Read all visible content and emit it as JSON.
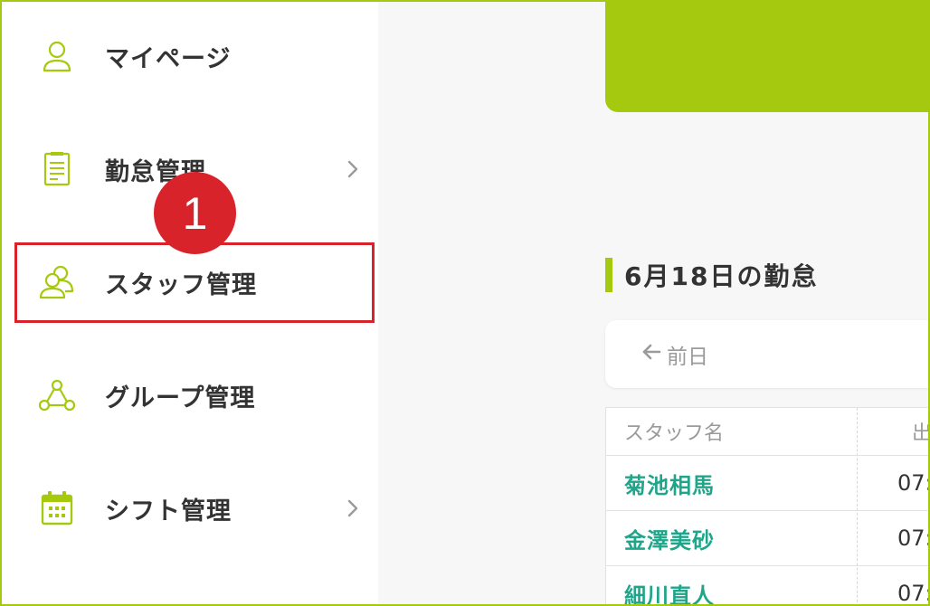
{
  "sidebar": {
    "items": [
      {
        "label": "マイページ",
        "icon": "user-icon",
        "has_chevron": false
      },
      {
        "label": "勤怠管理",
        "icon": "document-icon",
        "has_chevron": true
      },
      {
        "label": "スタッフ管理",
        "icon": "users-icon",
        "has_chevron": false,
        "highlighted": true
      },
      {
        "label": "グループ管理",
        "icon": "group-network-icon",
        "has_chevron": false
      },
      {
        "label": "シフト管理",
        "icon": "calendar-icon",
        "has_chevron": true
      }
    ]
  },
  "annotation": {
    "step_number": "1"
  },
  "main": {
    "section_title": "6月18日の勤怠",
    "prev_label": "前日",
    "table": {
      "headers": [
        "スタッフ名",
        "出"
      ],
      "rows": [
        {
          "name": "菊池相馬",
          "time": "07:"
        },
        {
          "name": "金澤美砂",
          "time": "07:"
        },
        {
          "name": "細川直人",
          "time": "07:"
        }
      ]
    }
  },
  "colors": {
    "accent": "#a5c90f",
    "highlight": "#d8232a",
    "link": "#1fa58a"
  }
}
